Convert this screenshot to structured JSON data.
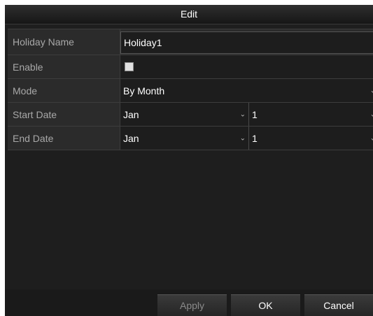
{
  "dialog": {
    "title": "Edit"
  },
  "form": {
    "holiday_name": {
      "label": "Holiday Name",
      "value": "Holiday1"
    },
    "enable": {
      "label": "Enable",
      "checked": false
    },
    "mode": {
      "label": "Mode",
      "value": "By Month"
    },
    "start_date": {
      "label": "Start Date",
      "month": "Jan",
      "day": "1"
    },
    "end_date": {
      "label": "End Date",
      "month": "Jan",
      "day": "1"
    }
  },
  "icons": {
    "dropdown": "chevron-down-icon"
  },
  "buttons": {
    "apply": "Apply",
    "ok": "OK",
    "cancel": "Cancel"
  }
}
